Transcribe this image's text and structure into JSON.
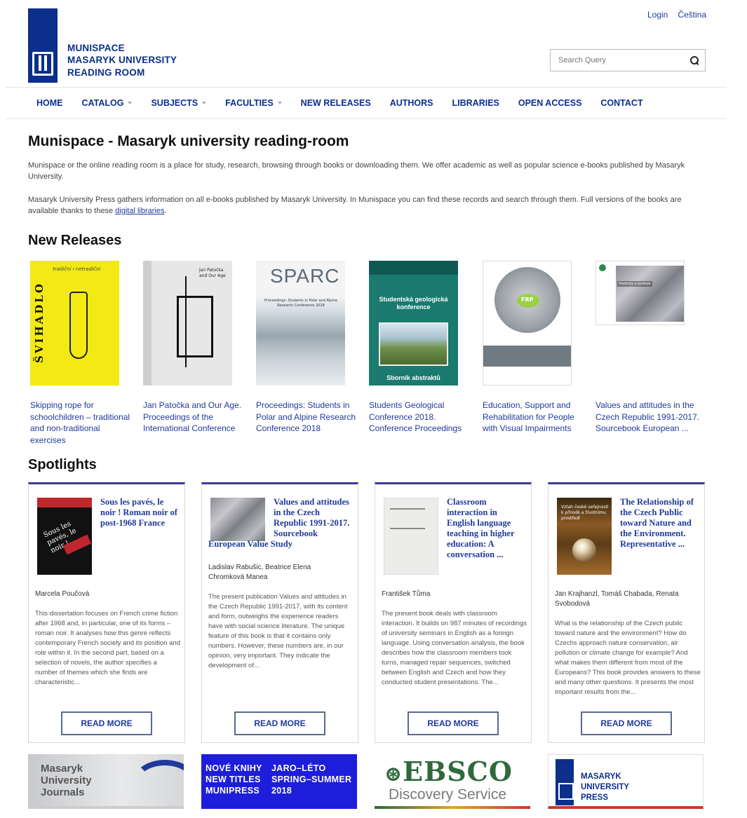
{
  "header": {
    "logo_lines": [
      "MUNISPACE",
      "MASARYK UNIVERSITY",
      "READING ROOM"
    ],
    "top_links": [
      "Login",
      "Čeština"
    ],
    "search_placeholder": "Search Query"
  },
  "nav": [
    {
      "label": "HOME",
      "dropdown": false
    },
    {
      "label": "CATALOG",
      "dropdown": true
    },
    {
      "label": "SUBJECTS",
      "dropdown": true
    },
    {
      "label": "FACULTIES",
      "dropdown": true
    },
    {
      "label": "NEW RELEASES",
      "dropdown": false
    },
    {
      "label": "AUTHORS",
      "dropdown": false
    },
    {
      "label": "LIBRARIES",
      "dropdown": false
    },
    {
      "label": "OPEN ACCESS",
      "dropdown": false
    },
    {
      "label": "CONTACT",
      "dropdown": false
    }
  ],
  "main": {
    "title": "Munispace - Masaryk university reading-room",
    "para1": "Munispace or the online reading room is a place for study, research, browsing through books or downloading them. We offer academic as well as popular science e-books published by Masaryk University.",
    "para2_before": "Masaryk University Press gathers information on all e-books published by Masaryk University. In Munispace you can find these records and search through them. Full versions of the books are available thanks to these ",
    "para2_link": "digital libraries",
    "para2_after": "."
  },
  "new_releases": {
    "heading": "New Releases",
    "items": [
      {
        "title": "Skipping rope for schoolchildren – traditional and non-traditional exercises",
        "cover_text": "ŠVIHADLO",
        "cover_sub": "tradiční i netradiční"
      },
      {
        "title": "Jan Patočka and Our Age. Proceedings of the International Conference",
        "cover_text": "Jan Patočka and Our Age"
      },
      {
        "title": "Proceedings: Students in Polar and Alpine Research Conference 2018",
        "cover_text": "SPARC",
        "cover_sub": "Proceedings: Students in Polar and Alpine Research Conference 2018"
      },
      {
        "title": "Students Geological Conference 2018. Conference Proceedings",
        "cover_text": "Studentská geologická konference",
        "cover_sub": "Sborník abstraktů"
      },
      {
        "title": "Education, Support and Rehabilitation for People with Visual Impairments",
        "cover_text": "FRP"
      },
      {
        "title": "Values and attitudes in the Czech Republic 1991-2017. Sourcebook European ...",
        "cover_text": "Hodnoty a postoje"
      }
    ]
  },
  "spotlights": {
    "heading": "Spotlights",
    "read_more": "READ MORE",
    "items": [
      {
        "title": "Sous les pavés, le noir ! Roman noir of post-1968 France",
        "cover_text": "Sous les pavés, le noir !",
        "authors": "Marcela Poučová",
        "desc": "This dissertation focuses on French crime fiction after 1968 and, in particular, one of its forms – roman noir. It analyses how this genre reflects contemporary French society and its position and role within it. In the second part, based on a selection of novels, the author specifies a number of themes which she finds are characteristic..."
      },
      {
        "title": "Values and attitudes in the Czech Republic 1991-2017. Sourcebook",
        "title_cont": "European Value Study",
        "authors": "Ladislav Rabušic, Beatrice Elena Chromková Manea",
        "desc": "The present publication Values and attitudes in the Czech Republic 1991-2017, with its content and form, outweighs the experience readers have with social science literature. The unique feature of this book is that it contains only numbers. However, these numbers are, in our opinion, very important. They indicate the development of..."
      },
      {
        "title": "Classroom interaction in English language teaching in higher education: A conversation ...",
        "authors": "František Tůma",
        "desc": "The present book deals with classroom interaction. It builds on 987 minutes of recordings of university seminars in English as a foreign language. Using conversation analysis, the book describes how the classroom members took turns, managed repair sequences, switched between English and Czech and how they conducted student presentations. The..."
      },
      {
        "title": "The Relationship of the Czech Public toward Nature and the Environment. Representative ...",
        "cover_text": "Vztah české veřejnosti k přírodě a životnímu prostředí",
        "authors": "Jan Krajhanzl, Tomáš Chabada, Renata Svobodová",
        "desc": "What is the relationship of the Czech public toward nature and the environment? How do Czechs approach nature conservation, air pollution or climate change for example? And what makes them different from most of the Europeans? This book provides answers to these and many other questions. It presents the most important results from the..."
      }
    ]
  },
  "banners": {
    "journals": [
      "Masaryk",
      "University",
      "Journals"
    ],
    "munipress_a": [
      "NOVÉ KNIHY",
      "NEW TITLES",
      "MUNIPRESS"
    ],
    "munipress_b": [
      "JARO–LÉTO",
      "SPRING–SUMMER",
      "2018"
    ],
    "ebsco": "EBSCO",
    "ebsco_sub": "Discovery Service",
    "press": [
      "MASARYK",
      "UNIVERSITY",
      "PRESS"
    ]
  }
}
